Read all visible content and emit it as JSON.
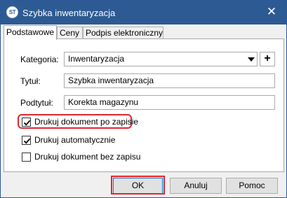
{
  "window": {
    "title": "Szybka inwentaryzacja",
    "app_icon_text": "ST",
    "close_symbol": "✕"
  },
  "tabs": [
    {
      "label": "Podstawowe",
      "active": true
    },
    {
      "label": "Ceny",
      "active": false
    },
    {
      "label": "Podpis elektroniczny",
      "active": false
    }
  ],
  "form": {
    "category": {
      "label": "Kategoria:",
      "value": "Inwentaryzacja",
      "add_symbol": "+"
    },
    "title": {
      "label": "Tytuł:",
      "value": "Szybka inwentaryzacja"
    },
    "subtitle": {
      "label": "Podtytuł:",
      "value": "Korekta magazynu"
    }
  },
  "options": [
    {
      "label": "Drukuj dokument po zapisie",
      "checked": true
    },
    {
      "label": "Drukuj automatycznie",
      "checked": true
    },
    {
      "label": "Drukuj dokument bez zapisu",
      "checked": false
    }
  ],
  "buttons": {
    "ok": "OK",
    "cancel": "Anuluj",
    "help": "Pomoc"
  },
  "colors": {
    "titlebar": "#2e5a93",
    "highlight": "#e0262f"
  },
  "icons": {
    "app": "app-logo-icon",
    "close": "close-icon",
    "dropdown": "chevron-down-icon",
    "check": "checkmark-icon"
  }
}
